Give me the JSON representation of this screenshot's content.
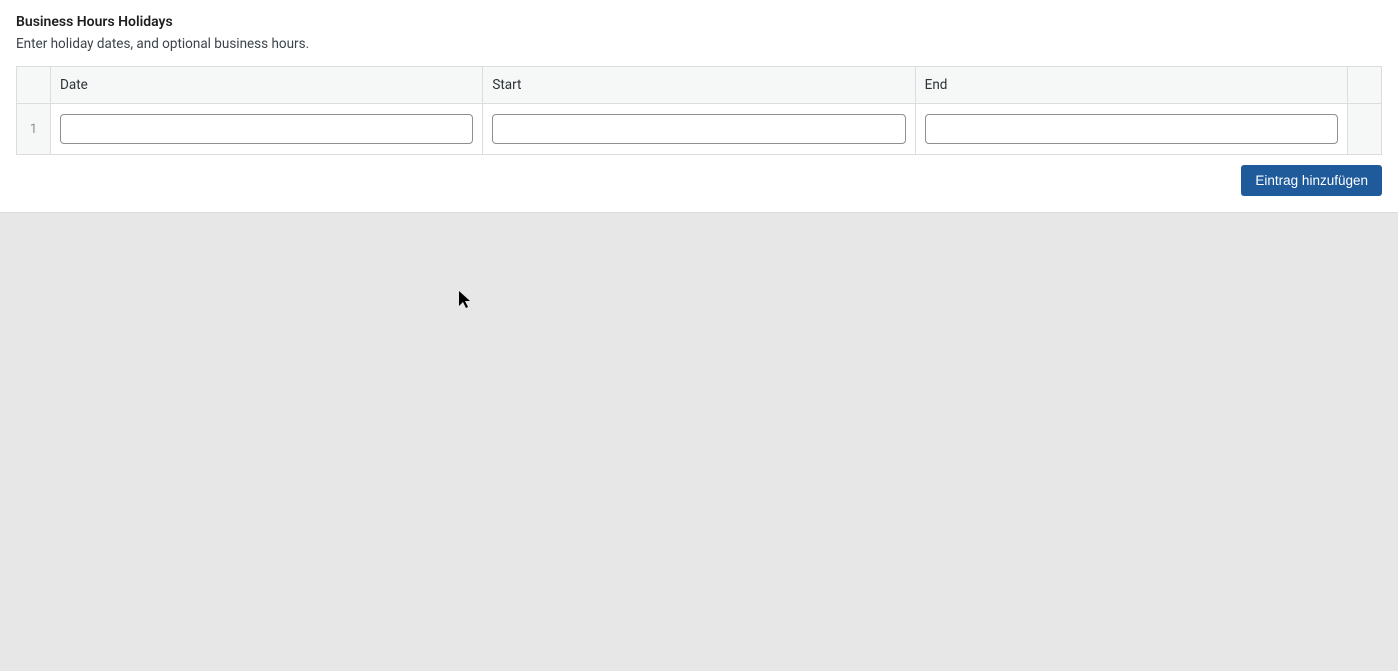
{
  "section": {
    "title": "Business Hours Holidays",
    "description": "Enter holiday dates, and optional business hours."
  },
  "table": {
    "columns": {
      "date": "Date",
      "start": "Start",
      "end": "End"
    },
    "rows": [
      {
        "index": "1",
        "date": "",
        "start": "",
        "end": ""
      }
    ]
  },
  "actions": {
    "add_entry": "Eintrag hinzufügen"
  }
}
